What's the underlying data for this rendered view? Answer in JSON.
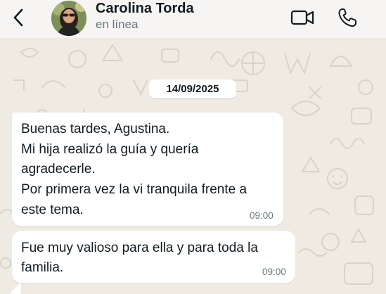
{
  "header": {
    "contact_name": "Carolina Torda",
    "status": "en línea",
    "icons": {
      "back": "back-arrow-icon",
      "video": "video-call-icon",
      "phone": "phone-call-icon"
    }
  },
  "chat": {
    "date_separator": "14/09/2025",
    "messages": [
      {
        "lines": [
          "Buenas tardes, Agustina.",
          "Mi hija realizó la guía y quería",
          "agradecerle.",
          "Por primera vez la vi tranquila frente a",
          "este tema."
        ],
        "time": "09:00"
      },
      {
        "lines": [
          "Fue muy valioso para ella y para toda la",
          "familia."
        ],
        "time": "09:00"
      }
    ]
  },
  "colors": {
    "background": "#efeae2",
    "header": "#f6f5f3",
    "bubble": "#ffffff",
    "secondary_text": "#667781"
  }
}
